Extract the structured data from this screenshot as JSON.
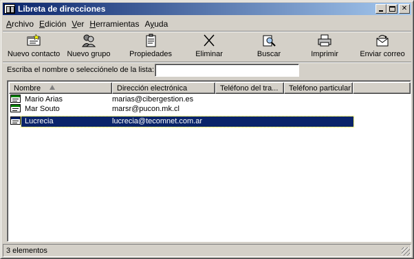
{
  "window": {
    "title": "Libreta de direcciones",
    "icon": "address-book-icon"
  },
  "menu": {
    "items": [
      {
        "label": "Archivo",
        "accel": "A"
      },
      {
        "label": "Edición",
        "accel": "E"
      },
      {
        "label": "Ver",
        "accel": "V"
      },
      {
        "label": "Herramientas",
        "accel": "H"
      },
      {
        "label": "Ayuda",
        "accel": "y"
      }
    ]
  },
  "toolbar": {
    "new_contact": "Nuevo contacto",
    "new_group": "Nuevo grupo",
    "properties": "Propiedades",
    "delete": "Eliminar",
    "find": "Buscar",
    "print": "Imprimir",
    "send_mail": "Enviar correo"
  },
  "search": {
    "label": "Escriba el nombre o selecciónelo de la lista:",
    "value": ""
  },
  "list": {
    "columns": [
      "Nombre",
      "Dirección electrónica",
      "Teléfono del tra...",
      "Teléfono particular"
    ],
    "rows": [
      {
        "name": "Mario Arias",
        "email": "marias@cibergestion.es",
        "work_phone": "",
        "home_phone": ""
      },
      {
        "name": "Mar Souto",
        "email": "marsr@pucon.mk.cl",
        "work_phone": "",
        "home_phone": ""
      },
      {
        "name": "Lucrecia",
        "email": "lucrecia@tecomnet.com.ar",
        "work_phone": "",
        "home_phone": "",
        "selected": true
      }
    ]
  },
  "status": {
    "text": "3 elementos"
  },
  "colors": {
    "title_start": "#0a246a",
    "title_end": "#a6caf0",
    "selection": "#0a246a",
    "face": "#d4d0c8"
  }
}
